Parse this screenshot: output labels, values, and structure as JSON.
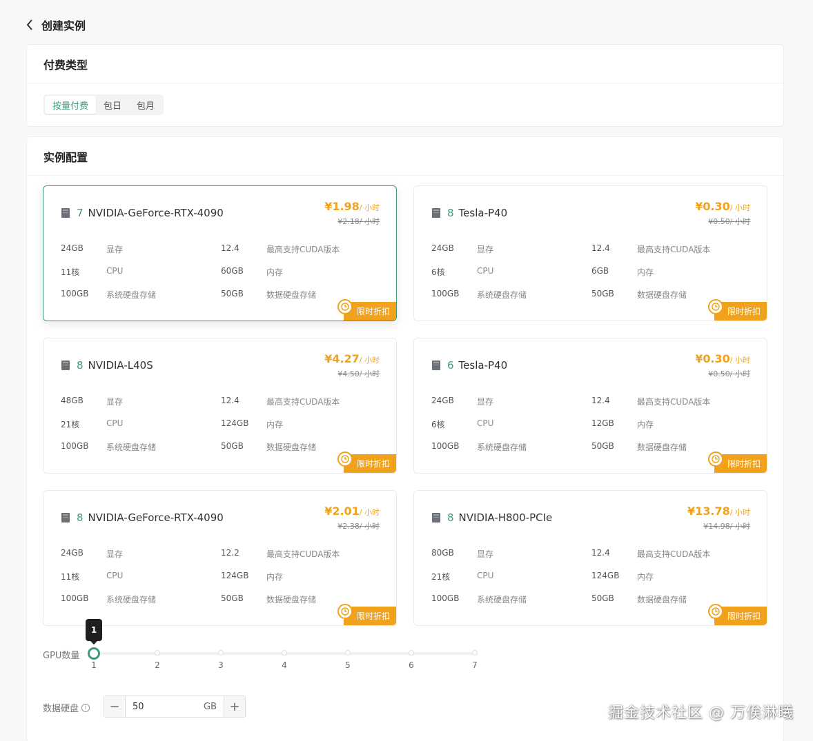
{
  "header": {
    "title": "创建实例"
  },
  "billing": {
    "title": "付费类型",
    "options": [
      "按量付费",
      "包日",
      "包月"
    ],
    "selected": 0
  },
  "config": {
    "title": "实例配置"
  },
  "instances": [
    {
      "count": "7",
      "name": "NVIDIA-GeForce-RTX-4090",
      "price": "¥1.98",
      "unit": "/ 小时",
      "old_price": "¥2.18/ 小时",
      "vram": "24GB",
      "vram_label": "显存",
      "cuda": "12.4",
      "cuda_label": "最高支持CUDA版本",
      "cpu": "11核",
      "cpu_label": "CPU",
      "mem": "60GB",
      "mem_label": "内存",
      "sys_disk": "100GB",
      "sys_disk_label": "系统硬盘存储",
      "data_disk": "50GB",
      "data_disk_label": "数据硬盘存储",
      "promo": "限时折扣",
      "selected": true
    },
    {
      "count": "8",
      "name": "Tesla-P40",
      "price": "¥0.30",
      "unit": "/ 小时",
      "old_price": "¥0.50/ 小时",
      "vram": "24GB",
      "vram_label": "显存",
      "cuda": "12.4",
      "cuda_label": "最高支持CUDA版本",
      "cpu": "6核",
      "cpu_label": "CPU",
      "mem": "6GB",
      "mem_label": "内存",
      "sys_disk": "100GB",
      "sys_disk_label": "系统硬盘存储",
      "data_disk": "50GB",
      "data_disk_label": "数据硬盘存储",
      "promo": "限时折扣",
      "selected": false
    },
    {
      "count": "8",
      "name": "NVIDIA-L40S",
      "price": "¥4.27",
      "unit": "/ 小时",
      "old_price": "¥4.50/ 小时",
      "vram": "48GB",
      "vram_label": "显存",
      "cuda": "12.4",
      "cuda_label": "最高支持CUDA版本",
      "cpu": "21核",
      "cpu_label": "CPU",
      "mem": "124GB",
      "mem_label": "内存",
      "sys_disk": "100GB",
      "sys_disk_label": "系统硬盘存储",
      "data_disk": "50GB",
      "data_disk_label": "数据硬盘存储",
      "promo": "限时折扣",
      "selected": false
    },
    {
      "count": "6",
      "name": "Tesla-P40",
      "price": "¥0.30",
      "unit": "/ 小时",
      "old_price": "¥0.50/ 小时",
      "vram": "24GB",
      "vram_label": "显存",
      "cuda": "12.4",
      "cuda_label": "最高支持CUDA版本",
      "cpu": "6核",
      "cpu_label": "CPU",
      "mem": "12GB",
      "mem_label": "内存",
      "sys_disk": "100GB",
      "sys_disk_label": "系统硬盘存储",
      "data_disk": "50GB",
      "data_disk_label": "数据硬盘存储",
      "promo": "限时折扣",
      "selected": false
    },
    {
      "count": "8",
      "name": "NVIDIA-GeForce-RTX-4090",
      "price": "¥2.01",
      "unit": "/ 小时",
      "old_price": "¥2.38/ 小时",
      "vram": "24GB",
      "vram_label": "显存",
      "cuda": "12.2",
      "cuda_label": "最高支持CUDA版本",
      "cpu": "11核",
      "cpu_label": "CPU",
      "mem": "124GB",
      "mem_label": "内存",
      "sys_disk": "100GB",
      "sys_disk_label": "系统硬盘存储",
      "data_disk": "50GB",
      "data_disk_label": "数据硬盘存储",
      "promo": "限时折扣",
      "selected": false
    },
    {
      "count": "8",
      "name": "NVIDIA-H800-PCIe",
      "price": "¥13.78",
      "unit": "/ 小时",
      "old_price": "¥14.98/ 小时",
      "vram": "80GB",
      "vram_label": "显存",
      "cuda": "12.4",
      "cuda_label": "最高支持CUDA版本",
      "cpu": "21核",
      "cpu_label": "CPU",
      "mem": "124GB",
      "mem_label": "内存",
      "sys_disk": "100GB",
      "sys_disk_label": "系统硬盘存储",
      "data_disk": "50GB",
      "data_disk_label": "数据硬盘存储",
      "promo": "限时折扣",
      "selected": false
    }
  ],
  "gpu_slider": {
    "label": "GPU数量",
    "ticks": [
      "1",
      "2",
      "3",
      "4",
      "5",
      "6",
      "7"
    ],
    "value": "1"
  },
  "data_disk": {
    "label": "数据硬盘",
    "value": "50",
    "unit": "GB"
  },
  "watermark": "掘金技术社区 @ 万俟淋曦",
  "colors": {
    "accent": "#3d9b7c",
    "price": "#f0a21c"
  }
}
